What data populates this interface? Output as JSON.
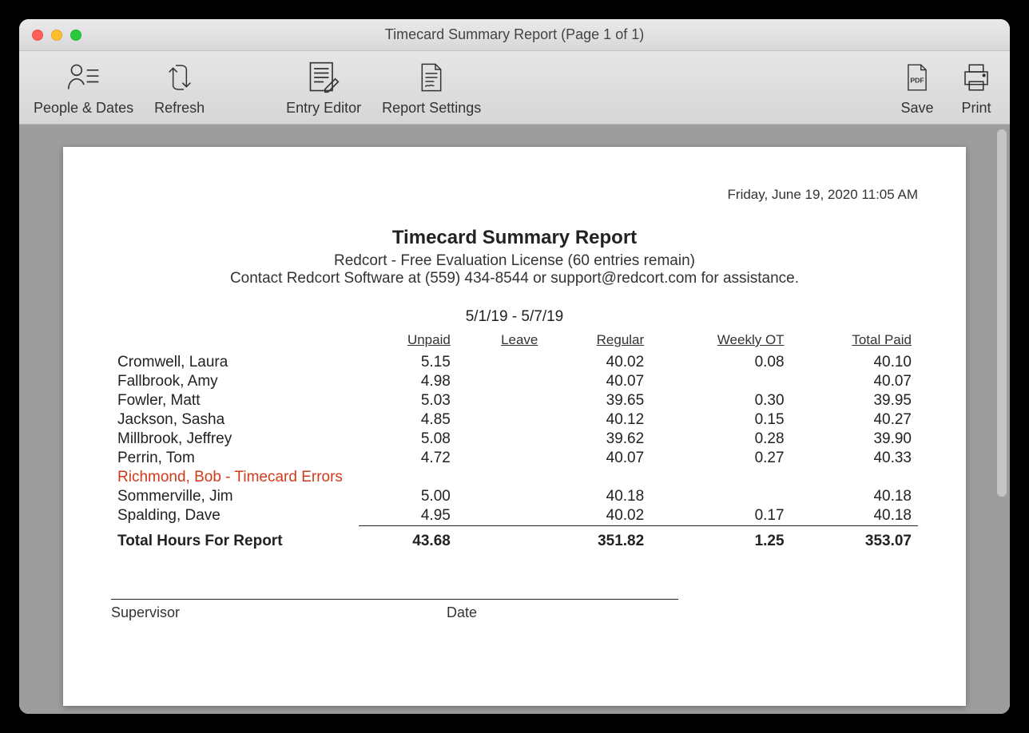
{
  "window": {
    "title": "Timecard Summary Report  (Page 1 of 1)"
  },
  "toolbar": {
    "people_dates": "People & Dates",
    "refresh": "Refresh",
    "entry_editor": "Entry Editor",
    "report_settings": "Report Settings",
    "save": "Save",
    "print": "Print",
    "pdf_badge": "PDF"
  },
  "report": {
    "timestamp": "Friday, June 19, 2020  11:05 AM",
    "title": "Timecard Summary Report",
    "subtitle1": "Redcort - Free Evaluation License (60 entries remain)",
    "subtitle2": "Contact Redcort Software at (559) 434-8544 or support@redcort.com for assistance.",
    "date_range": "5/1/19 - 5/7/19",
    "columns": {
      "name": "",
      "unpaid": "Unpaid",
      "leave": "Leave",
      "regular": "Regular",
      "weekly_ot": "Weekly OT",
      "total_paid": "Total Paid"
    },
    "rows": [
      {
        "name": "Cromwell, Laura",
        "unpaid": "5.15",
        "leave": "",
        "regular": "40.02",
        "weekly_ot": "0.08",
        "total_paid": "40.10",
        "error": false
      },
      {
        "name": "Fallbrook, Amy",
        "unpaid": "4.98",
        "leave": "",
        "regular": "40.07",
        "weekly_ot": "",
        "total_paid": "40.07",
        "error": false
      },
      {
        "name": "Fowler, Matt",
        "unpaid": "5.03",
        "leave": "",
        "regular": "39.65",
        "weekly_ot": "0.30",
        "total_paid": "39.95",
        "error": false
      },
      {
        "name": "Jackson, Sasha",
        "unpaid": "4.85",
        "leave": "",
        "regular": "40.12",
        "weekly_ot": "0.15",
        "total_paid": "40.27",
        "error": false
      },
      {
        "name": "Millbrook, Jeffrey",
        "unpaid": "5.08",
        "leave": "",
        "regular": "39.62",
        "weekly_ot": "0.28",
        "total_paid": "39.90",
        "error": false
      },
      {
        "name": "Perrin, Tom",
        "unpaid": "4.72",
        "leave": "",
        "regular": "40.07",
        "weekly_ot": "0.27",
        "total_paid": "40.33",
        "error": false
      },
      {
        "name": "Richmond, Bob - Timecard Errors",
        "unpaid": "",
        "leave": "",
        "regular": "",
        "weekly_ot": "",
        "total_paid": "",
        "error": true
      },
      {
        "name": "Sommerville, Jim",
        "unpaid": "5.00",
        "leave": "",
        "regular": "40.18",
        "weekly_ot": "",
        "total_paid": "40.18",
        "error": false
      },
      {
        "name": "Spalding, Dave",
        "unpaid": "4.95",
        "leave": "",
        "regular": "40.02",
        "weekly_ot": "0.17",
        "total_paid": "40.18",
        "error": false
      }
    ],
    "totals": {
      "label": "Total Hours For Report",
      "unpaid": "43.68",
      "leave": "",
      "regular": "351.82",
      "weekly_ot": "1.25",
      "total_paid": "353.07"
    },
    "signature": {
      "supervisor": "Supervisor",
      "date": "Date"
    }
  }
}
